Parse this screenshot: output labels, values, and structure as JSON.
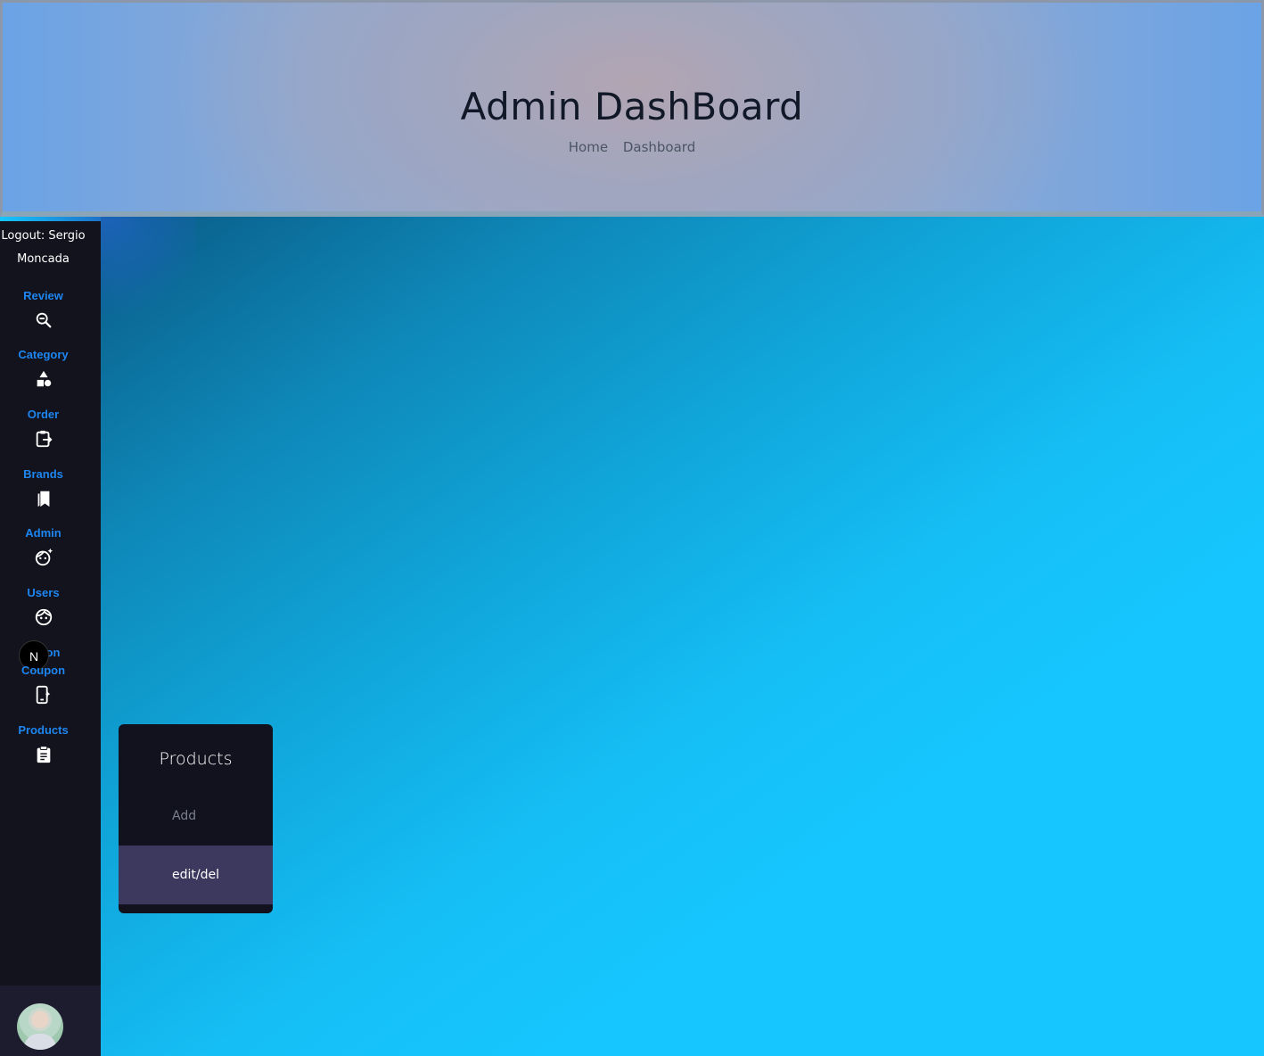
{
  "header": {
    "title": "Admin DashBoard",
    "breadcrumb": [
      "Home",
      "Dashboard"
    ]
  },
  "sidebar": {
    "logout_label": "Logout: Sergio Moncada",
    "items": [
      {
        "label": "Review",
        "icon": "search-minus-icon"
      },
      {
        "label": "Category",
        "icon": "shapes-icon"
      },
      {
        "label": "Order",
        "icon": "clipboard-arrow-icon"
      },
      {
        "label": "Brands",
        "icon": "bookmarks-icon"
      },
      {
        "label": "Admin",
        "icon": "face-sparkle-icon"
      },
      {
        "label": "Users",
        "icon": "face-icon"
      },
      {
        "label": "Coupon",
        "icon": "phone-sparkle-icon"
      },
      {
        "label": "Products",
        "icon": "clipboard-list-icon"
      }
    ],
    "overlay_badge": "N",
    "overlay_ghost_text": "on"
  },
  "popup": {
    "title": "Products",
    "items": [
      "Add",
      "edit/del"
    ]
  },
  "colors": {
    "sidebar_bg": "#13131e",
    "nav_label": "#1d86f0",
    "active_item": "#3c385e",
    "main_bg": "#16c4fd"
  }
}
